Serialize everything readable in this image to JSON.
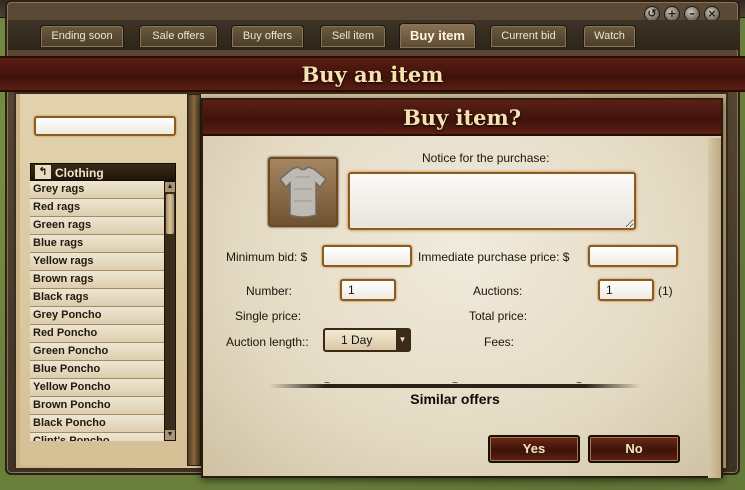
{
  "tabs": [
    {
      "label": "Ending soon"
    },
    {
      "label": "Sale offers"
    },
    {
      "label": "Buy offers"
    },
    {
      "label": "Sell item"
    },
    {
      "label": "Buy item"
    },
    {
      "label": "Current bid"
    },
    {
      "label": "Watch"
    }
  ],
  "page_title": "Buy an item",
  "search": {
    "value": ""
  },
  "category": {
    "label": "Clothing"
  },
  "items": [
    "Grey rags",
    "Red rags",
    "Green rags",
    "Blue rags",
    "Yellow rags",
    "Brown rags",
    "Black rags",
    "Grey Poncho",
    "Red Poncho",
    "Green Poncho",
    "Blue Poncho",
    "Yellow Poncho",
    "Brown Poncho",
    "Black Poncho",
    "Clint's Poncho"
  ],
  "dialog": {
    "title": "Buy item?",
    "notice_label": "Notice for the purchase:",
    "notice_value": "",
    "min_bid_label": "Minimum bid: $",
    "min_bid_value": "",
    "immediate_label": "Immediate purchase price: $",
    "immediate_value": "",
    "number_label": "Number:",
    "number_value": "1",
    "auctions_label": "Auctions:",
    "auctions_value": "1",
    "auctions_count": "(1)",
    "single_price_label": "Single price:",
    "total_price_label": "Total price:",
    "auction_length_label": "Auction length::",
    "auction_length_value": "1 Day",
    "fees_label": "Fees:",
    "similar_offers": "Similar offers",
    "yes_label": "Yes",
    "no_label": "No"
  },
  "colors": {
    "accent_red": "#4a160c",
    "parchment": "#e5dcc7",
    "field_border": "#8a5a1e"
  },
  "icons": [
    "history-icon",
    "plus-icon",
    "minimize-icon",
    "close-icon",
    "back-arrow-icon",
    "chevron-down-icon",
    "grey-shirt-icon"
  ]
}
